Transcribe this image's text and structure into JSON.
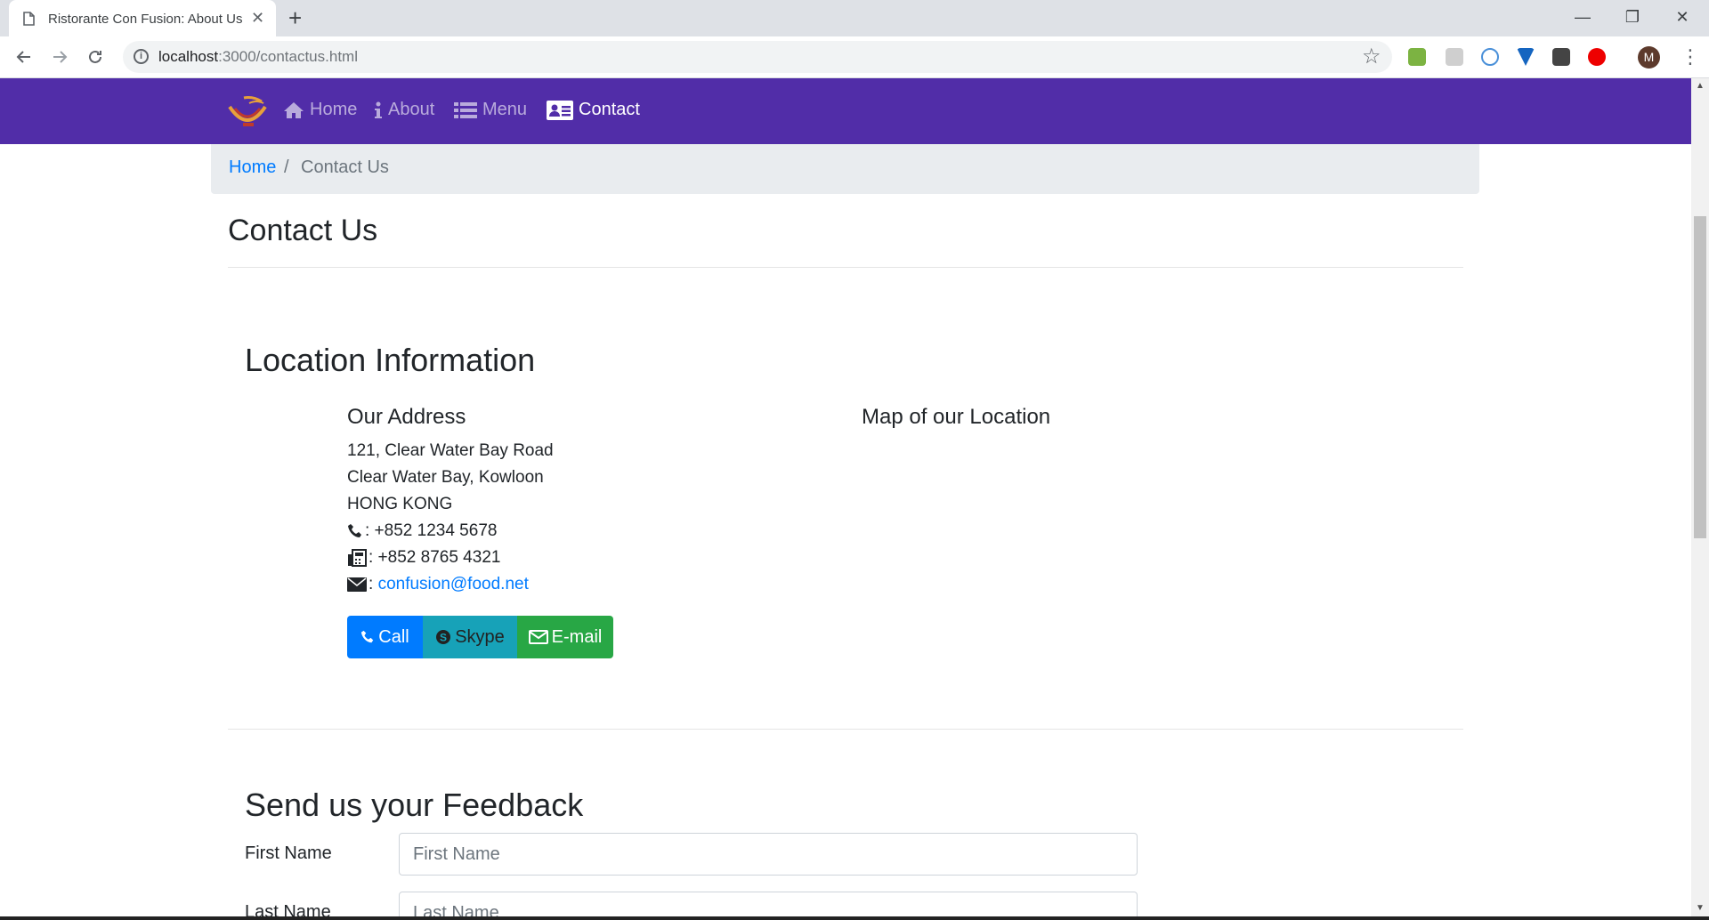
{
  "browser": {
    "tab_title": "Ristorante Con Fusion: About Us",
    "tab_close": "✕",
    "new_tab": "+",
    "url_host": "localhost",
    "url_path": ":3000/contactus.html",
    "window_controls": [
      "—",
      "❐",
      "✕"
    ],
    "profile_initial": "M",
    "icons": [
      "page-icon",
      "back-arrow-icon",
      "forward-arrow-icon",
      "reload-icon",
      "info-icon",
      "star-icon",
      "menu-kebab-icon"
    ]
  },
  "navbar": {
    "brand_color": "#512da8",
    "items": [
      {
        "label": "Home",
        "icon": "home-icon",
        "active": false
      },
      {
        "label": "About",
        "icon": "info-icon",
        "active": false
      },
      {
        "label": "Menu",
        "icon": "list-icon",
        "active": false
      },
      {
        "label": "Contact",
        "icon": "address-card-icon",
        "active": true
      }
    ]
  },
  "breadcrumb": {
    "home": "Home",
    "separator": "/",
    "current": "Contact Us"
  },
  "page_title": "Contact Us",
  "location": {
    "heading": "Location Information",
    "address_heading": "Our Address",
    "address_lines": [
      "121, Clear Water Bay Road",
      "Clear Water Bay, Kowloon",
      "HONG KONG"
    ],
    "phone": ": +852 1234 5678",
    "fax": ": +852 8765 4321",
    "email_prefix": ": ",
    "email": "confusion@food.net",
    "map_heading": "Map of our Location"
  },
  "buttons": {
    "call": "Call",
    "skype": "Skype",
    "email": "E-mail",
    "colors": {
      "call": "#007bff",
      "skype": "#17a2b8",
      "email": "#28a745"
    }
  },
  "feedback": {
    "heading": "Send us your Feedback",
    "first_name_label": "First Name",
    "first_name_placeholder": "First Name",
    "last_name_label": "Last Name",
    "last_name_placeholder": "Last Name"
  }
}
